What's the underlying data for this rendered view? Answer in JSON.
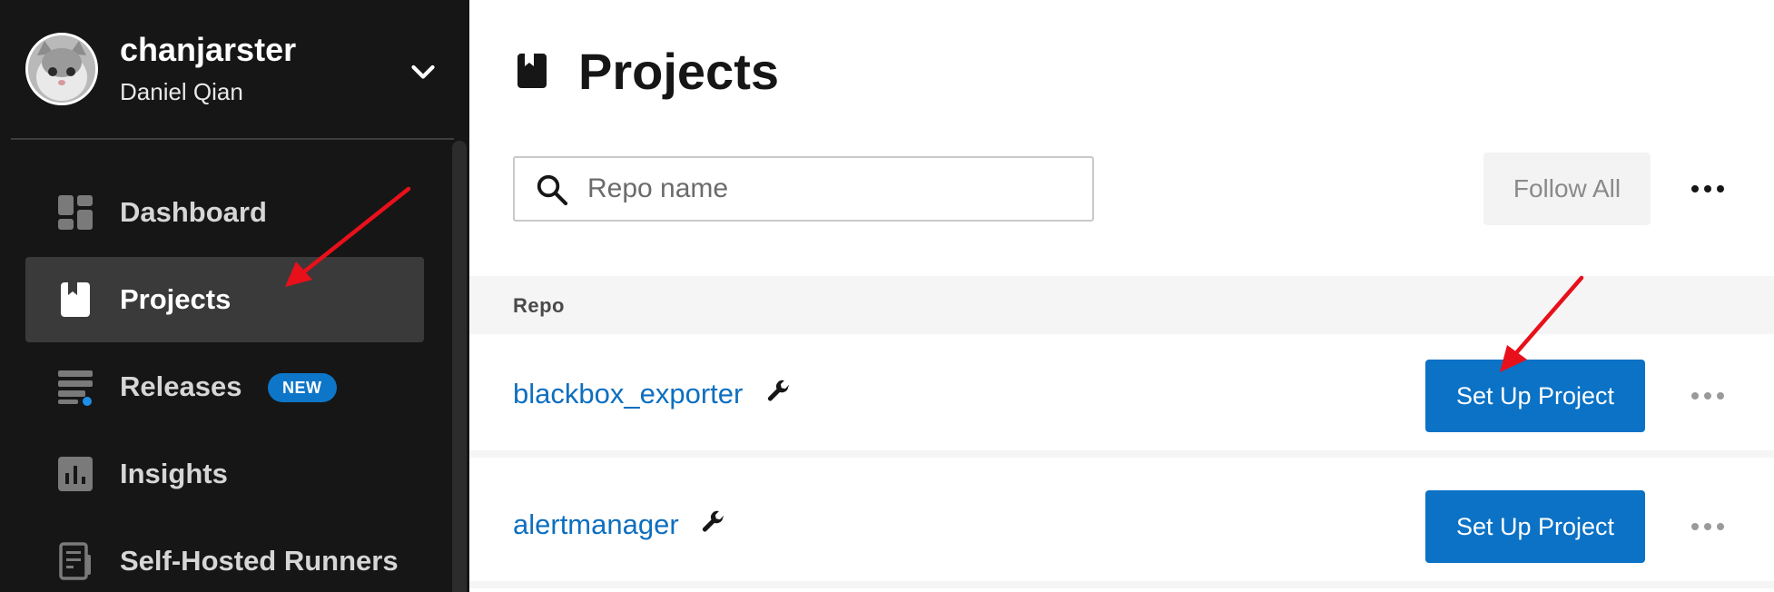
{
  "sidebar": {
    "profile": {
      "username": "chanjarster",
      "full_name": "Daniel Qian"
    },
    "items": [
      {
        "label": "Dashboard",
        "icon": "dashboard-icon",
        "active": false
      },
      {
        "label": "Projects",
        "icon": "project-book-icon",
        "active": true
      },
      {
        "label": "Releases",
        "icon": "releases-icon",
        "active": false,
        "badge": "NEW"
      },
      {
        "label": "Insights",
        "icon": "insights-chart-icon",
        "active": false
      },
      {
        "label": "Self-Hosted Runners",
        "icon": "runner-doc-icon",
        "active": false
      }
    ]
  },
  "main": {
    "title": "Projects",
    "search": {
      "placeholder": "Repo name",
      "value": ""
    },
    "follow_all_label": "Follow All",
    "table": {
      "column_header": "Repo",
      "rows": [
        {
          "repo": "blackbox_exporter",
          "action_label": "Set Up Project"
        },
        {
          "repo": "alertmanager",
          "action_label": "Set Up Project"
        }
      ]
    }
  },
  "colors": {
    "sidebar_bg": "#161616",
    "active_item_bg": "#3a3a3a",
    "primary_button": "#0b72c6",
    "link": "#0e6fbf",
    "badge": "#0e76c8",
    "annotation_arrow": "#e8101a"
  }
}
